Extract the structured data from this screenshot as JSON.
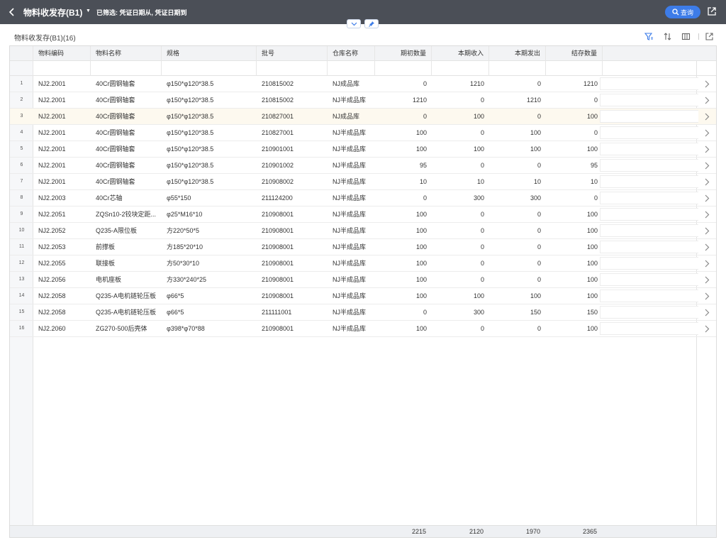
{
  "header": {
    "title": "物料收发存(B1)",
    "filter_text": "已筛选: 凭证日期从, 凭证日期到",
    "query_label": "查询"
  },
  "subheader": {
    "title": "物料收发存(B1)(16)"
  },
  "table": {
    "columns": [
      "物料编码",
      "物料名称",
      "规格",
      "批号",
      "仓库名称",
      "期初数量",
      "本期收入",
      "本期发出",
      "结存数量"
    ],
    "rows": [
      {
        "no": "1",
        "code": "NJ2.2001",
        "name": "40Cr圆钢轴套",
        "spec": "φ150*φ120*38.5",
        "batch": "210815002",
        "wh": "NJ成品库",
        "open": "0",
        "in": "1210",
        "out": "0",
        "bal": "1210"
      },
      {
        "no": "2",
        "code": "NJ2.2001",
        "name": "40Cr圆钢轴套",
        "spec": "φ150*φ120*38.5",
        "batch": "210815002",
        "wh": "NJ半成品库",
        "open": "1210",
        "in": "0",
        "out": "1210",
        "bal": "0"
      },
      {
        "no": "3",
        "code": "NJ2.2001",
        "name": "40Cr圆钢轴套",
        "spec": "φ150*φ120*38.5",
        "batch": "210827001",
        "wh": "NJ成品库",
        "open": "0",
        "in": "100",
        "out": "0",
        "bal": "100"
      },
      {
        "no": "4",
        "code": "NJ2.2001",
        "name": "40Cr圆钢轴套",
        "spec": "φ150*φ120*38.5",
        "batch": "210827001",
        "wh": "NJ半成品库",
        "open": "100",
        "in": "0",
        "out": "100",
        "bal": "0"
      },
      {
        "no": "5",
        "code": "NJ2.2001",
        "name": "40Cr圆钢轴套",
        "spec": "φ150*φ120*38.5",
        "batch": "210901001",
        "wh": "NJ半成品库",
        "open": "100",
        "in": "100",
        "out": "100",
        "bal": "100"
      },
      {
        "no": "6",
        "code": "NJ2.2001",
        "name": "40Cr圆钢轴套",
        "spec": "φ150*φ120*38.5",
        "batch": "210901002",
        "wh": "NJ半成品库",
        "open": "95",
        "in": "0",
        "out": "0",
        "bal": "95"
      },
      {
        "no": "7",
        "code": "NJ2.2001",
        "name": "40Cr圆钢轴套",
        "spec": "φ150*φ120*38.5",
        "batch": "210908002",
        "wh": "NJ半成品库",
        "open": "10",
        "in": "10",
        "out": "10",
        "bal": "10"
      },
      {
        "no": "8",
        "code": "NJ2.2003",
        "name": "40Cr芯轴",
        "spec": "φ55*150",
        "batch": "211124200",
        "wh": "NJ半成品库",
        "open": "0",
        "in": "300",
        "out": "300",
        "bal": "0"
      },
      {
        "no": "9",
        "code": "NJ2.2051",
        "name": "ZQSn10-2铰块定距...",
        "spec": "φ25*M16*10",
        "batch": "210908001",
        "wh": "NJ半成品库",
        "open": "100",
        "in": "0",
        "out": "0",
        "bal": "100"
      },
      {
        "no": "10",
        "code": "NJ2.2052",
        "name": "Q235-A限位板",
        "spec": "方220*50*5",
        "batch": "210908001",
        "wh": "NJ半成品库",
        "open": "100",
        "in": "0",
        "out": "0",
        "bal": "100"
      },
      {
        "no": "11",
        "code": "NJ2.2053",
        "name": "前撑板",
        "spec": "方185*20*10",
        "batch": "210908001",
        "wh": "NJ半成品库",
        "open": "100",
        "in": "0",
        "out": "0",
        "bal": "100"
      },
      {
        "no": "12",
        "code": "NJ2.2055",
        "name": "联接板",
        "spec": "方50*30*10",
        "batch": "210908001",
        "wh": "NJ半成品库",
        "open": "100",
        "in": "0",
        "out": "0",
        "bal": "100"
      },
      {
        "no": "13",
        "code": "NJ2.2056",
        "name": "电机座板",
        "spec": "方330*240*25",
        "batch": "210908001",
        "wh": "NJ半成品库",
        "open": "100",
        "in": "0",
        "out": "0",
        "bal": "100"
      },
      {
        "no": "14",
        "code": "NJ2.2058",
        "name": "Q235-A电机链轮压板",
        "spec": "φ66*5",
        "batch": "210908001",
        "wh": "NJ半成品库",
        "open": "100",
        "in": "100",
        "out": "100",
        "bal": "100"
      },
      {
        "no": "15",
        "code": "NJ2.2058",
        "name": "Q235-A电机链轮压板",
        "spec": "φ66*5",
        "batch": "211111001",
        "wh": "NJ半成品库",
        "open": "0",
        "in": "300",
        "out": "150",
        "bal": "150"
      },
      {
        "no": "16",
        "code": "NJ2.2060",
        "name": "ZG270-500后壳体",
        "spec": "φ398*φ70*88",
        "batch": "210908001",
        "wh": "NJ半成品库",
        "open": "100",
        "in": "0",
        "out": "0",
        "bal": "100"
      }
    ],
    "totals": {
      "open": "2215",
      "in": "2120",
      "out": "1970",
      "bal": "2365"
    },
    "highlighted_row": 3
  },
  "icons": {
    "back": "chevron-left-icon",
    "dropdown": "caret-down-icon",
    "search": "search-icon",
    "export": "export-icon",
    "collapse": "chevron-down-icon",
    "pin": "pin-icon",
    "filter": "filter-icon",
    "sort": "sort-icon",
    "columns": "columns-icon",
    "row_detail": "chevron-right-icon"
  },
  "colors": {
    "topbar": "#4b4f57",
    "accent": "#3d7ce8",
    "highlight_row": "#fdf9ef"
  }
}
